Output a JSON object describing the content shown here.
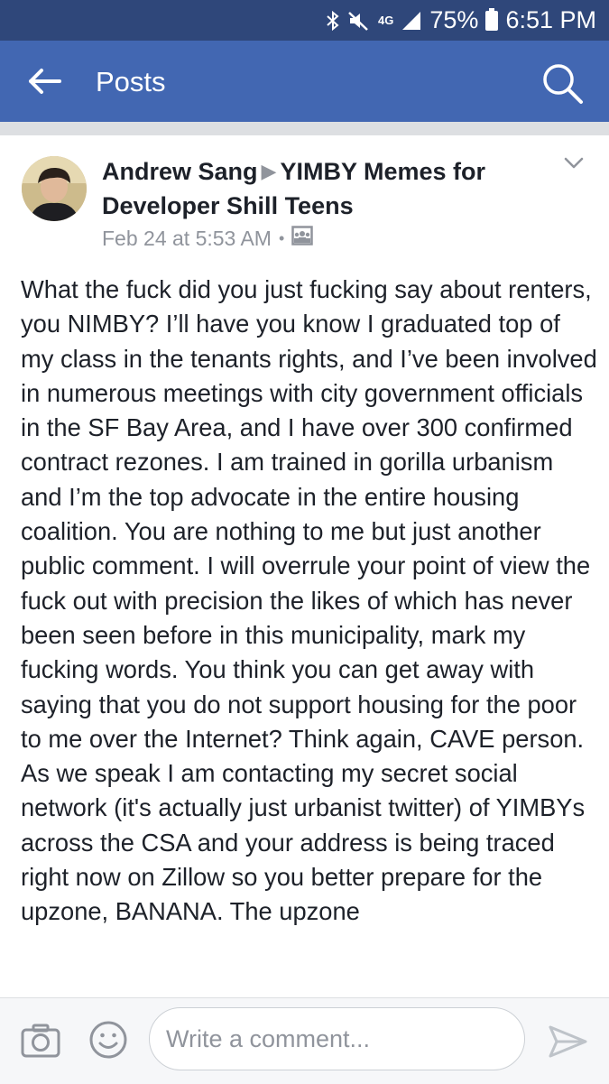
{
  "status_bar": {
    "network": "4G",
    "battery": "75%",
    "time": "6:51 PM"
  },
  "nav": {
    "title": "Posts",
    "back_icon": "back-arrow-icon",
    "search_icon": "search-icon"
  },
  "post": {
    "author": "Andrew Sang",
    "group": "YIMBY Memes for Developer Shill Teens",
    "timestamp": "Feb 24 at 5:53 AM",
    "dot": "•",
    "audience_icon": "group-audience-icon",
    "menu_icon": "chevron-down-icon",
    "body": "What the fuck did you just fucking say about renters, you NIMBY? I’ll have you know I graduated top of my class in the tenants rights, and I’ve been involved in numerous meetings with city government officials in the SF Bay Area, and I have over 300 confirmed contract rezones. I am trained in gorilla urbanism and I’m the top advocate in the entire housing coalition. You are nothing to me but just another public comment. I will overrule your point of view the fuck out with precision the likes of which has never been seen before in this municipality, mark my fucking words. You think you can get away with saying that you do not support housing for the poor to me over the Internet? Think again, CAVE person. As we speak I am contacting my secret social network (it's actually just urbanist twitter) of YIMBYs across the CSA and your address is being traced right now on Zillow so you better prepare for the upzone, BANANA. The upzone"
  },
  "comment_bar": {
    "placeholder": "Write a comment...",
    "camera_icon": "camera-icon",
    "emoji_icon": "emoji-icon",
    "send_icon": "send-icon"
  },
  "colors": {
    "status_bar": "#2f477a",
    "nav_bar": "#4267b2",
    "text": "#1d2129",
    "secondary_text": "#90949c",
    "divider": "#dddfe2"
  }
}
